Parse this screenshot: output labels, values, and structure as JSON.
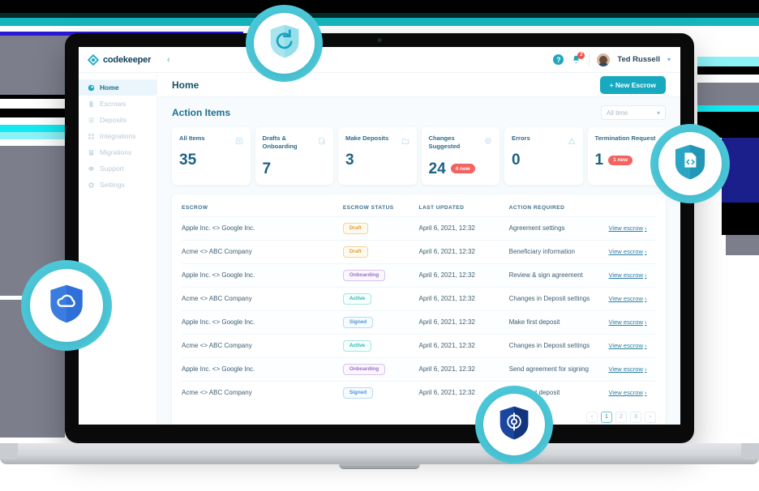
{
  "brand": {
    "name": "codekeeper",
    "logo_icon": "diamond-logo-icon",
    "accent": "#17a9c0"
  },
  "topbar": {
    "collapse_icon": "chevron-left-icon",
    "help_icon": "help-circle-icon",
    "help_label": "?",
    "bell_icon": "bell-icon",
    "bell_badge": "2",
    "user_name": "Ted Russell",
    "avatar_icon": "user-avatar",
    "user_chevron_icon": "chevron-down-icon"
  },
  "sidebar": {
    "items": [
      {
        "label": "Home",
        "icon": "home-icon",
        "active": true
      },
      {
        "label": "Escrows",
        "icon": "document-icon",
        "active": false
      },
      {
        "label": "Deposits",
        "icon": "list-icon",
        "active": false
      },
      {
        "label": "Integrations",
        "icon": "grid-icon",
        "active": false
      },
      {
        "label": "Migrations",
        "icon": "archive-icon",
        "active": false
      },
      {
        "label": "Support",
        "icon": "chat-bubble-icon",
        "active": false
      },
      {
        "label": "Settings",
        "icon": "gear-icon",
        "active": false
      }
    ]
  },
  "page": {
    "title": "Home",
    "new_escrow_label": "+ New Escrow",
    "section_title": "Action Items",
    "time_filter": {
      "value": "All time",
      "chevron_icon": "chevron-down-icon"
    }
  },
  "cards": [
    {
      "label": "All Items",
      "value": "35",
      "icon": "list-box-icon",
      "badge": ""
    },
    {
      "label": "Drafts & Onboarding",
      "value": "7",
      "icon": "edit-document-icon",
      "badge": ""
    },
    {
      "label": "Make Deposits",
      "value": "3",
      "icon": "folder-icon",
      "badge": ""
    },
    {
      "label": "Changes Suggested",
      "value": "24",
      "icon": "gear-icon",
      "badge": "4 new"
    },
    {
      "label": "Errors",
      "value": "0",
      "icon": "warning-triangle-icon",
      "badge": ""
    },
    {
      "label": "Termination Request",
      "value": "1",
      "icon": "",
      "badge": "1 new"
    }
  ],
  "table": {
    "columns": [
      "ESCROW",
      "ESCROW STATUS",
      "LAST UPDATED",
      "ACTION REQUIRED",
      ""
    ],
    "link_label": "View escrow",
    "link_arrow": "›",
    "rows": [
      {
        "escrow": "Apple Inc. <> Google Inc.",
        "status": "Draft",
        "status_kind": "draft",
        "updated": "April 6, 2021, 12:32",
        "action": "Agreement settings"
      },
      {
        "escrow": "Acme <> ABC Company",
        "status": "Draft",
        "status_kind": "draft",
        "updated": "April 6, 2021, 12:32",
        "action": "Beneficiary information"
      },
      {
        "escrow": "Apple Inc. <> Google Inc.",
        "status": "Onboarding",
        "status_kind": "onboarding",
        "updated": "April 6, 2021, 12:32",
        "action": "Review & sign agreement"
      },
      {
        "escrow": "Acme <> ABC Company",
        "status": "Active",
        "status_kind": "active",
        "updated": "April 6, 2021, 12:32",
        "action": "Changes in Deposit settings"
      },
      {
        "escrow": "Apple Inc. <> Google Inc.",
        "status": "Signed",
        "status_kind": "signed",
        "updated": "April 6, 2021, 12:32",
        "action": "Make first deposit"
      },
      {
        "escrow": "Acme <> ABC Company",
        "status": "Active",
        "status_kind": "active",
        "updated": "April 6, 2021, 12:32",
        "action": "Changes in Deposit settings"
      },
      {
        "escrow": "Apple Inc. <> Google Inc.",
        "status": "Onboarding",
        "status_kind": "onboarding",
        "updated": "April 6, 2021, 12:32",
        "action": "Send agreement for signing"
      },
      {
        "escrow": "Acme <> ABC Company",
        "status": "Signed",
        "status_kind": "signed",
        "updated": "April 6, 2021, 12:32",
        "action": "Make first deposit"
      }
    ]
  },
  "pagination": {
    "prev_label": "›",
    "next_label": "›",
    "pages": [
      "1",
      "2",
      "3"
    ],
    "active_page": "1"
  },
  "floating_badges": [
    {
      "name": "shield-refresh-badge",
      "icon": "shield-refresh-icon",
      "shield_color": "#a8e5ef",
      "glyph_color": "#16a2bd"
    },
    {
      "name": "shield-code-badge",
      "icon": "shield-code-icon",
      "shield_color": "#2aa6c4",
      "glyph_color": "#ffffff"
    },
    {
      "name": "shield-cloud-badge",
      "icon": "shield-cloud-icon",
      "shield_color": "#2f6fd8",
      "glyph_color": "#ffffff"
    },
    {
      "name": "shield-target-badge",
      "icon": "shield-target-icon",
      "shield_color": "#12357e",
      "glyph_color": "#ffffff"
    }
  ]
}
